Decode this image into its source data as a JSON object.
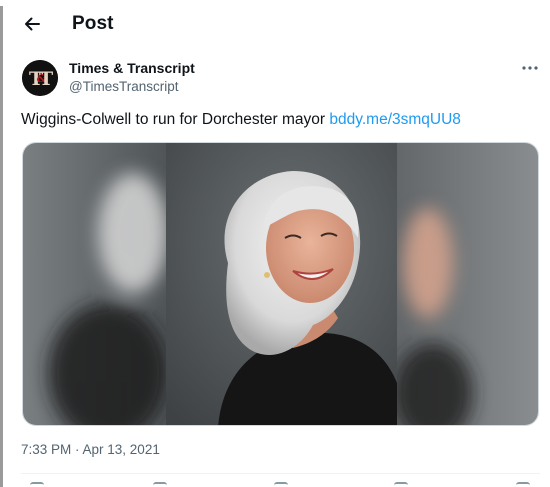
{
  "header": {
    "back_icon": "arrow-left-icon",
    "title": "Post"
  },
  "tweet": {
    "author": {
      "name": "Times & Transcript",
      "handle": "@TimesTranscript",
      "avatar_text": "T&T",
      "avatar_colors": {
        "background": "#111111",
        "letters": "#e5d2c0",
        "accent": "#c0181e"
      }
    },
    "more_icon": "more-horizontal-icon",
    "text": "Wiggins-Colwell to run for Dorchester mayor",
    "link": "bddy.me/3smqUU8",
    "media": {
      "description_icon": "portrait-photo-icon"
    },
    "timestamp": "7:33 PM · Apr 13, 2021"
  },
  "colors": {
    "link": "#1d9bf0",
    "secondary_text": "#536471",
    "primary_text": "#0f1419"
  }
}
